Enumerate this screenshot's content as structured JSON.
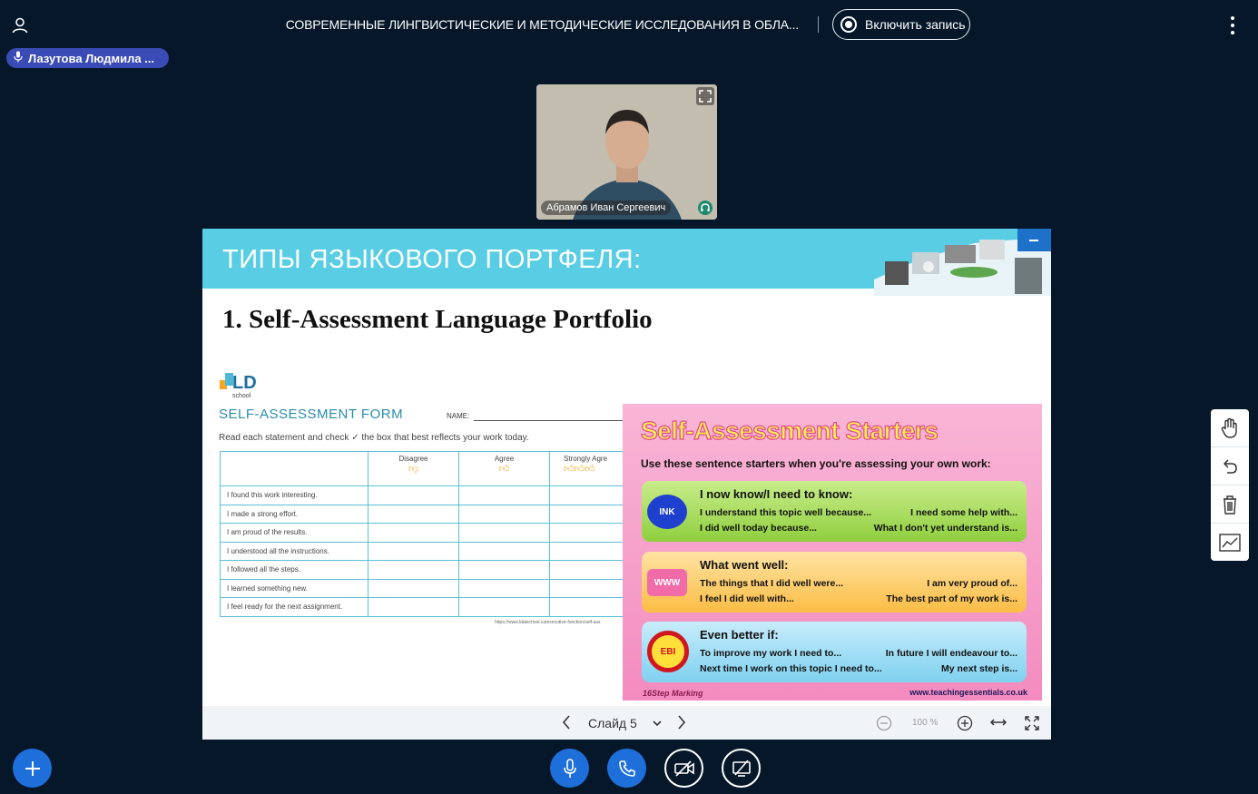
{
  "header": {
    "title": "СОВРЕМЕННЫЕ ЛИНГВИСТИЧЕСКИЕ И МЕТОДИЧЕСКИЕ ИССЛЕДОВАНИЯ В ОБЛА...",
    "record_label": "Включить запись"
  },
  "talker": {
    "name": "Лазутова Людмила ..."
  },
  "webcam": {
    "name": "Абрамов Иван Сергеевич"
  },
  "slide": {
    "banner_title": "ТИПЫ ЯЗЫКОВОГО ПОРТФЕЛЯ:",
    "heading": "1. Self-Assessment Language Portfolio",
    "form": {
      "logo_text": "LD",
      "logo_sub": "school",
      "title": "SELF-ASSESSMENT FORM",
      "name_label": "NAME:",
      "instructions": "Read each statement and check ✓ the box that best reflects your work today.",
      "columns": [
        "Disagree",
        "Agree",
        "Strongly Agre"
      ],
      "rows": [
        "I found this work interesting.",
        "I made a strong effort.",
        "I am proud of the results.",
        "I understood all the instructions.",
        "I followed all the steps.",
        "I learned something new.",
        "I feel ready for the next assignment."
      ],
      "url": "https://www.ldatschool.ca/executive-function/self-ass"
    },
    "poster": {
      "title": "Self-Assessment Starters",
      "subtitle": "Use these sentence starters when you're assessing your own work:",
      "boxes": [
        {
          "badge": "INK",
          "heading": "I now know/I need to know:",
          "l1": "I understand this topic well because...",
          "r1": "I need some help with...",
          "l2": "I did well today because...",
          "r2": "What I don't yet understand is..."
        },
        {
          "badge": "WWW",
          "heading": "What went well:",
          "l1": "The things that I did well were...",
          "r1": "I am very proud of...",
          "l2": "I feel I did well with...",
          "r2": "The best part of my work is..."
        },
        {
          "badge": "EBI",
          "heading": "Even better if:",
          "l1": "To improve my work I need to...",
          "r1": "In future I will endeavour to...",
          "l2": "Next time I work on this topic I need to...",
          "r2": "My next step is..."
        }
      ],
      "footer_left": "16Step Marking",
      "footer_right": "www.teachingessentials.co.uk"
    }
  },
  "slide_bar": {
    "slide_label": "Слайд 5",
    "zoom": "100 %"
  },
  "colors": {
    "background": "#06172a",
    "accent": "#1e6fd9",
    "banner": "#58cde3"
  }
}
